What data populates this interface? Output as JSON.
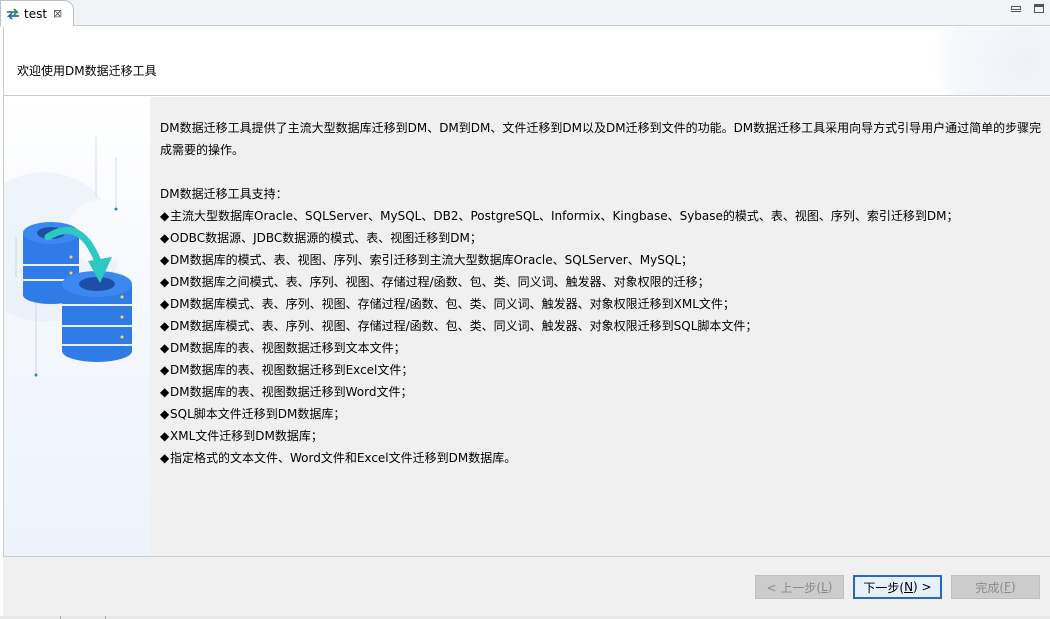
{
  "tab": {
    "title": "test",
    "close_glyph": "⊠",
    "icon": "transfer-arrows-icon"
  },
  "header": {
    "title": "欢迎使用DM数据迁移工具"
  },
  "intro": {
    "line1": "DM数据迁移工具提供了主流大型数据库迁移到DM、DM到DM、文件迁移到DM以及DM迁移到文件的功能。DM数据迁移工具采用向导方式引导用户通过简单的步骤完",
    "line2": "成需要的操作。"
  },
  "support": {
    "heading": "DM数据迁移工具支持：",
    "bullet_glyph": "◆",
    "items": [
      "主流大型数据库Oracle、SQLServer、MySQL、DB2、PostgreSQL、Informix、Kingbase、Sybase的模式、表、视图、序列、索引迁移到DM；",
      "ODBC数据源、JDBC数据源的模式、表、视图迁移到DM；",
      "DM数据库的模式、表、视图、序列、索引迁移到主流大型数据库Oracle、SQLServer、MySQL；",
      "DM数据库之间模式、表、序列、视图、存储过程/函数、包、类、同义词、触发器、对象权限的迁移；",
      "DM数据库模式、表、序列、视图、存储过程/函数、包、类、同义词、触发器、对象权限迁移到XML文件；",
      "DM数据库模式、表、序列、视图、存储过程/函数、包、类、同义词、触发器、对象权限迁移到SQL脚本文件；",
      "DM数据库的表、视图数据迁移到文本文件；",
      "DM数据库的表、视图数据迁移到Excel文件；",
      "DM数据库的表、视图数据迁移到Word文件；",
      "SQL脚本文件迁移到DM数据库；",
      "XML文件迁移到DM数据库；",
      "指定格式的文本文件、Word文件和Excel文件迁移到DM数据库。"
    ]
  },
  "buttons": {
    "prev": {
      "before": "< 上一步(",
      "mnemonic": "L",
      "after": ")"
    },
    "next": {
      "before": "下一步(",
      "mnemonic": "N",
      "after": ") >"
    },
    "finish": {
      "before": "完成(",
      "mnemonic": "F",
      "after": ")"
    }
  },
  "colors": {
    "accent": "#2a68bd",
    "db_blue": "#2f7be8",
    "arrow_teal": "#2ec8c2"
  }
}
